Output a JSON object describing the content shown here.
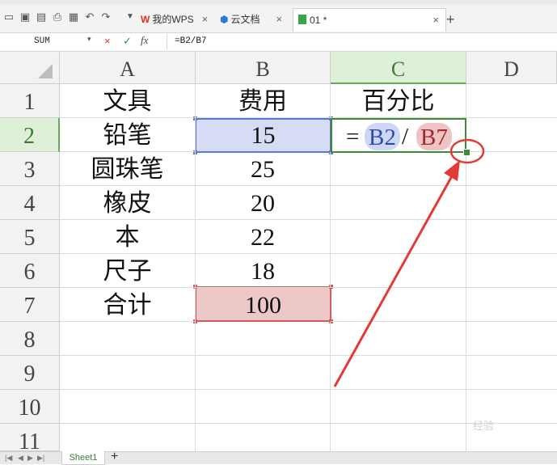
{
  "toolbar": {
    "tabs": [
      {
        "label": "我的WPS",
        "close": "×"
      },
      {
        "label": "云文档",
        "close": "×"
      },
      {
        "label": "01 *",
        "close": "×"
      }
    ],
    "new_tab": "+"
  },
  "formula_bar": {
    "name_box": "SUM",
    "cancel": "×",
    "confirm": "✓",
    "fx": "fx",
    "formula": "=B2/B7"
  },
  "grid": {
    "columns": [
      "A",
      "B",
      "C",
      "D"
    ],
    "rows": [
      "1",
      "2",
      "3",
      "4",
      "5",
      "6",
      "7",
      "8",
      "9",
      "10",
      "11"
    ],
    "cells": {
      "A1": "文具",
      "B1": "费用",
      "C1": "百分比",
      "A2": "铅笔",
      "B2": "15",
      "A3": "圆珠笔",
      "B3": "25",
      "A4": "橡皮",
      "B4": "20",
      "A5": "本",
      "B5": "22",
      "A6": "尺子",
      "B6": "18",
      "A7": "合计",
      "B7": "100"
    },
    "active_cell": "C2",
    "active_formula": {
      "eq": "=",
      "ref1": "B2",
      "slash": "/",
      "ref2": "B7"
    }
  },
  "sheets": {
    "tabs": [
      "Sheet1"
    ],
    "add": "+"
  },
  "colors": {
    "ref1": "#5b78d1",
    "ref2": "#d25c5c",
    "active": "#3f8a34",
    "annotation": "#e53935"
  },
  "watermark": "经验"
}
